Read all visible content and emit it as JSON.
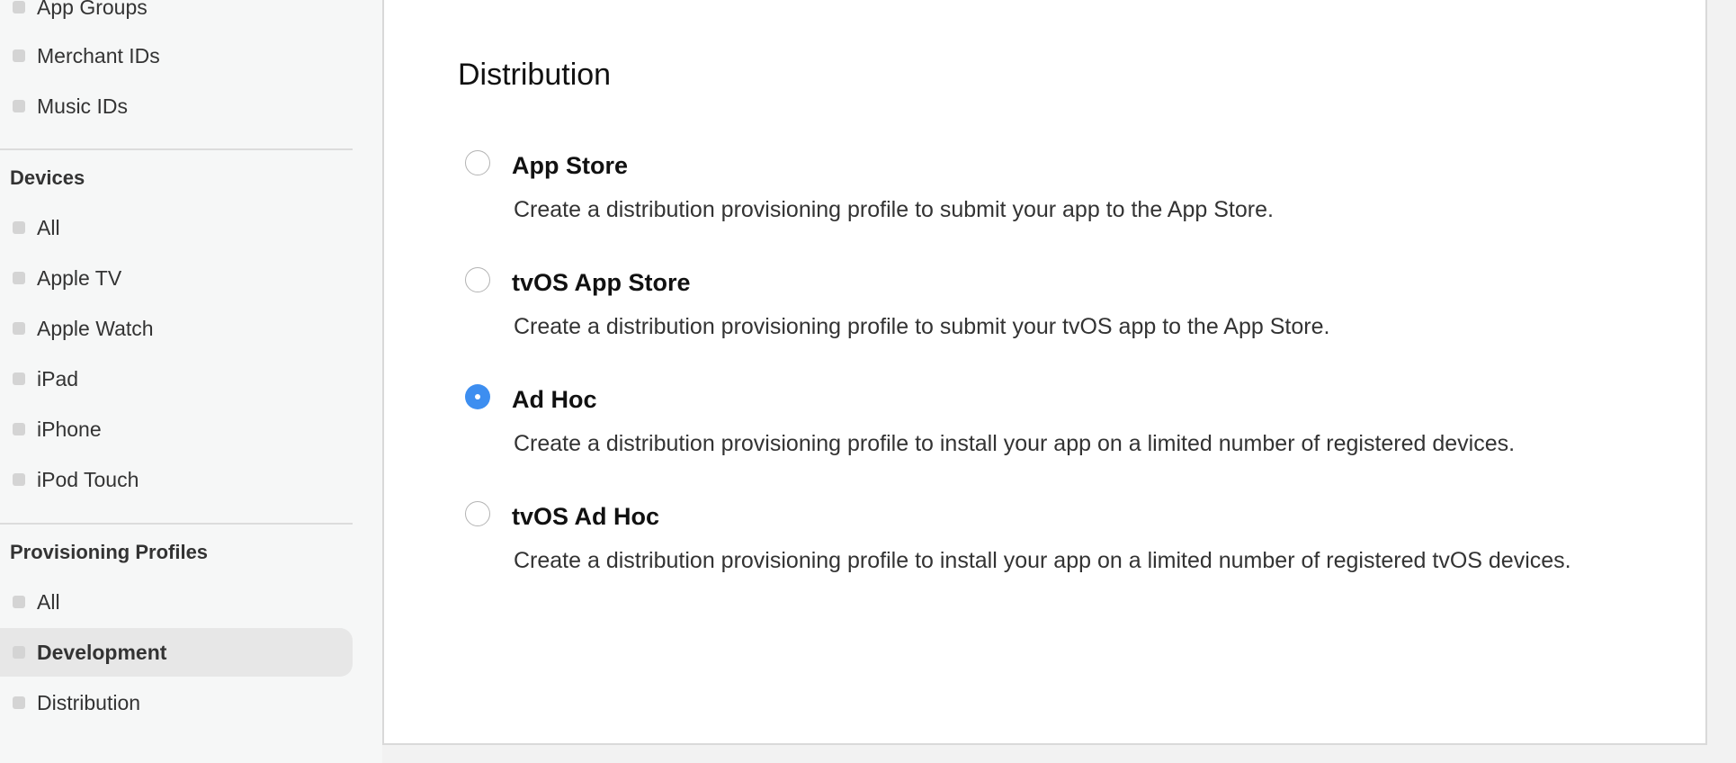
{
  "sidebar": {
    "identifiers_items": [
      {
        "label": "App Groups"
      },
      {
        "label": "Merchant IDs"
      },
      {
        "label": "Music IDs"
      }
    ],
    "devices": {
      "heading": "Devices",
      "items": [
        {
          "label": "All"
        },
        {
          "label": "Apple TV"
        },
        {
          "label": "Apple Watch"
        },
        {
          "label": "iPad"
        },
        {
          "label": "iPhone"
        },
        {
          "label": "iPod Touch"
        }
      ]
    },
    "profiles": {
      "heading": "Provisioning Profiles",
      "items": [
        {
          "label": "All",
          "active": false
        },
        {
          "label": "Development",
          "active": true
        },
        {
          "label": "Distribution",
          "active": false
        }
      ]
    }
  },
  "main": {
    "section_title": "Distribution",
    "options": [
      {
        "title": "App Store",
        "description": "Create a distribution provisioning profile to submit your app to the App Store.",
        "selected": false
      },
      {
        "title": "tvOS App Store",
        "description": "Create a distribution provisioning profile to submit your tvOS app to the App Store.",
        "selected": false
      },
      {
        "title": "Ad Hoc",
        "description": "Create a distribution provisioning profile to install your app on a limited number of registered devices.",
        "selected": true
      },
      {
        "title": "tvOS Ad Hoc",
        "description": "Create a distribution provisioning profile to install your app on a limited number of registered tvOS devices.",
        "selected": false
      }
    ]
  },
  "colors": {
    "accent": "#3d8ef0",
    "sidebar_bg": "#f6f7f7",
    "active_item_bg": "#e7e7e7"
  }
}
